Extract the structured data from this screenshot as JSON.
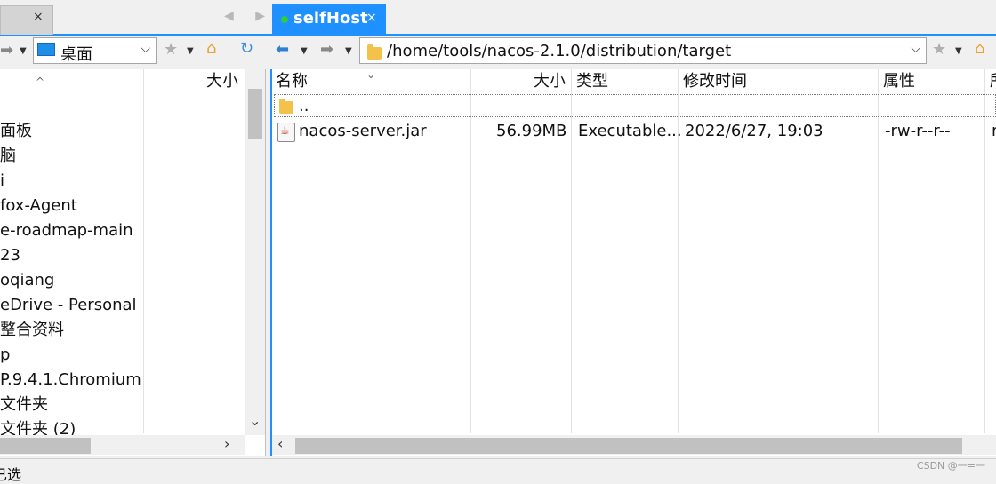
{
  "tabs": {
    "left": {
      "close": "×"
    },
    "nav_arrows": "◀ ▶",
    "active": {
      "label": "selfHost",
      "close": "×"
    }
  },
  "left_toolbar": {
    "location": "桌面"
  },
  "right_toolbar": {
    "path": "/home/tools/nacos-2.1.0/distribution/target"
  },
  "left_panel": {
    "header_size": "大小",
    "items": [
      "面板",
      "脑",
      "i",
      "fox-Agent",
      "e-roadmap-main",
      "23",
      "oqiang",
      "eDrive - Personal",
      "整合资料",
      "p",
      "P.9.4.1.Chromium",
      "文件夹",
      "文件夹 (2)"
    ]
  },
  "right_panel": {
    "columns": [
      "名称",
      "大小",
      "类型",
      "修改时间",
      "属性",
      "所"
    ],
    "updir": "..",
    "files": [
      {
        "name": "nacos-server.jar",
        "size": "56.99MB",
        "type": "Executable...",
        "modified": "2022/6/27, 19:03",
        "attrs": "-rw-r--r--",
        "owner": "r"
      }
    ]
  },
  "status": {
    "left_text": "已选",
    "watermark": "CSDN @一=一"
  },
  "colors": {
    "accent": "#1e90ff",
    "online_dot": "#2ecc40"
  }
}
